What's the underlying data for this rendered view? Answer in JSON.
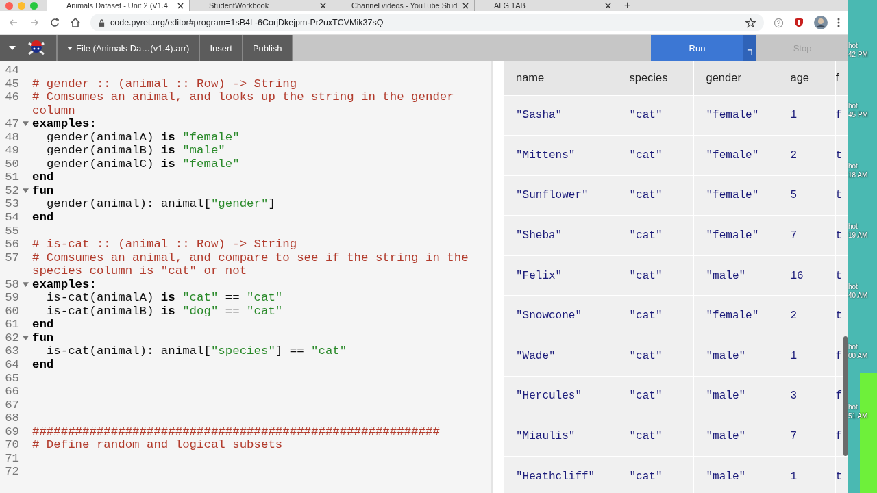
{
  "browser": {
    "tabs": [
      {
        "label": "Animals Dataset - Unit 2 (V1.4",
        "selected": true
      },
      {
        "label": "StudentWorkbook",
        "selected": false
      },
      {
        "label": "Channel videos - YouTube Stud",
        "selected": false
      },
      {
        "label": "ALG 1AB",
        "selected": false
      }
    ],
    "new_tab": "+",
    "url": "code.pyret.org/editor#program=1sB4L-6CorjDkejpm-Pr2uxTCVMik37sQ"
  },
  "toolbar": {
    "file_menu": "File (Animals Da…(v1.4).arr)",
    "insert": "Insert",
    "publish": "Publish",
    "run": "Run",
    "stop": {
      "label": "Stop",
      "disabled": true
    }
  },
  "editor": {
    "lines": [
      {
        "number": "44",
        "foldable": false
      },
      {
        "number": "45",
        "foldable": false,
        "tokens": [
          {
            "kind": "comment",
            "text": "# gender :: (animal :: Row) -> String"
          }
        ]
      },
      {
        "number": "46",
        "foldable": false,
        "tokens": [
          {
            "kind": "comment",
            "text": "# Comsumes an animal, and looks up the string in the gender column"
          }
        ]
      },
      {
        "number": "47",
        "foldable": true,
        "tokens": [
          {
            "kind": "keyword",
            "text": "examples:"
          }
        ]
      },
      {
        "number": "48",
        "foldable": false,
        "tokens": [
          {
            "kind": "plain",
            "text": "  gender(animalA) "
          },
          {
            "kind": "keyword",
            "text": "is "
          },
          {
            "kind": "string",
            "text": "\"female\""
          }
        ]
      },
      {
        "number": "49",
        "foldable": false,
        "tokens": [
          {
            "kind": "plain",
            "text": "  gender(animalB) "
          },
          {
            "kind": "keyword",
            "text": "is "
          },
          {
            "kind": "string",
            "text": "\"male\""
          }
        ]
      },
      {
        "number": "50",
        "foldable": false,
        "tokens": [
          {
            "kind": "plain",
            "text": "  gender(animalC) "
          },
          {
            "kind": "keyword",
            "text": "is "
          },
          {
            "kind": "string",
            "text": "\"female\""
          }
        ]
      },
      {
        "number": "51",
        "foldable": false,
        "tokens": [
          {
            "kind": "keyword",
            "text": "end"
          }
        ]
      },
      {
        "number": "52",
        "foldable": true,
        "tokens": [
          {
            "kind": "keyword",
            "text": "fun"
          }
        ]
      },
      {
        "number": "53",
        "foldable": false,
        "tokens": [
          {
            "kind": "plain",
            "text": "  gender(animal): animal["
          },
          {
            "kind": "string",
            "text": "\"gender\""
          },
          {
            "kind": "plain",
            "text": "]"
          }
        ]
      },
      {
        "number": "54",
        "foldable": false,
        "tokens": [
          {
            "kind": "keyword",
            "text": "end"
          }
        ]
      },
      {
        "number": "55",
        "foldable": false
      },
      {
        "number": "56",
        "foldable": false,
        "tokens": [
          {
            "kind": "comment",
            "text": "# is-cat :: (animal :: Row) -> String"
          }
        ]
      },
      {
        "number": "57",
        "foldable": false,
        "tokens": [
          {
            "kind": "comment",
            "text": "# Comsumes an animal, and compare to see if the string in the species column is \"cat\" or not"
          }
        ]
      },
      {
        "number": "58",
        "foldable": true,
        "tokens": [
          {
            "kind": "keyword",
            "text": "examples:"
          }
        ]
      },
      {
        "number": "59",
        "foldable": false,
        "tokens": [
          {
            "kind": "plain",
            "text": "  is-cat(animalA) "
          },
          {
            "kind": "keyword",
            "text": "is "
          },
          {
            "kind": "string",
            "text": "\"cat\""
          },
          {
            "kind": "plain",
            "text": " == "
          },
          {
            "kind": "string",
            "text": "\"cat\""
          }
        ]
      },
      {
        "number": "60",
        "foldable": false,
        "tokens": [
          {
            "kind": "plain",
            "text": "  is-cat(animalB) "
          },
          {
            "kind": "keyword",
            "text": "is "
          },
          {
            "kind": "string",
            "text": "\"dog\""
          },
          {
            "kind": "plain",
            "text": " == "
          },
          {
            "kind": "string",
            "text": "\"cat\""
          }
        ]
      },
      {
        "number": "61",
        "foldable": false,
        "tokens": [
          {
            "kind": "keyword",
            "text": "end"
          }
        ]
      },
      {
        "number": "62",
        "foldable": true,
        "tokens": [
          {
            "kind": "keyword",
            "text": "fun"
          }
        ]
      },
      {
        "number": "63",
        "foldable": false,
        "tokens": [
          {
            "kind": "plain",
            "text": "  is-cat(animal): animal["
          },
          {
            "kind": "string",
            "text": "\"species\""
          },
          {
            "kind": "plain",
            "text": "] == "
          },
          {
            "kind": "string",
            "text": "\"cat\""
          }
        ]
      },
      {
        "number": "64",
        "foldable": false,
        "tokens": [
          {
            "kind": "keyword",
            "text": "end"
          }
        ]
      },
      {
        "number": "65",
        "foldable": false
      },
      {
        "number": "66",
        "foldable": false
      },
      {
        "number": "67",
        "foldable": false
      },
      {
        "number": "68",
        "foldable": false
      },
      {
        "number": "69",
        "foldable": false,
        "tokens": [
          {
            "kind": "comment",
            "text": "#########################################################"
          }
        ]
      },
      {
        "number": "70",
        "foldable": false,
        "tokens": [
          {
            "kind": "comment",
            "text": "# Define random and logical subsets"
          }
        ]
      },
      {
        "number": "71",
        "foldable": false
      },
      {
        "number": "72",
        "foldable": false
      }
    ]
  },
  "table": {
    "columns": [
      "name",
      "species",
      "gender",
      "age",
      "f"
    ],
    "rows": [
      [
        "\"Sasha\"",
        "\"cat\"",
        "\"female\"",
        "1",
        "f"
      ],
      [
        "\"Mittens\"",
        "\"cat\"",
        "\"female\"",
        "2",
        "t"
      ],
      [
        "\"Sunflower\"",
        "\"cat\"",
        "\"female\"",
        "5",
        "t"
      ],
      [
        "\"Sheba\"",
        "\"cat\"",
        "\"female\"",
        "7",
        "t"
      ],
      [
        "\"Felix\"",
        "\"cat\"",
        "\"male\"",
        "16",
        "t"
      ],
      [
        "\"Snowcone\"",
        "\"cat\"",
        "\"female\"",
        "2",
        "t"
      ],
      [
        "\"Wade\"",
        "\"cat\"",
        "\"male\"",
        "1",
        "f"
      ],
      [
        "\"Hercules\"",
        "\"cat\"",
        "\"male\"",
        "3",
        "f"
      ],
      [
        "\"Miaulis\"",
        "\"cat\"",
        "\"male\"",
        "7",
        "f"
      ],
      [
        "\"Heathcliff\"",
        "\"cat\"",
        "\"male\"",
        "1",
        "t"
      ]
    ]
  },
  "desktop": {
    "labels": [
      [
        "hot",
        "42 PM"
      ],
      [
        "hot",
        "45 PM"
      ],
      [
        "hot",
        "18 AM"
      ],
      [
        "hot",
        "19 AM"
      ],
      [
        "hot",
        "40 AM"
      ],
      [
        "hot",
        "00 AM"
      ],
      [
        "hot",
        "51 AM"
      ]
    ]
  }
}
